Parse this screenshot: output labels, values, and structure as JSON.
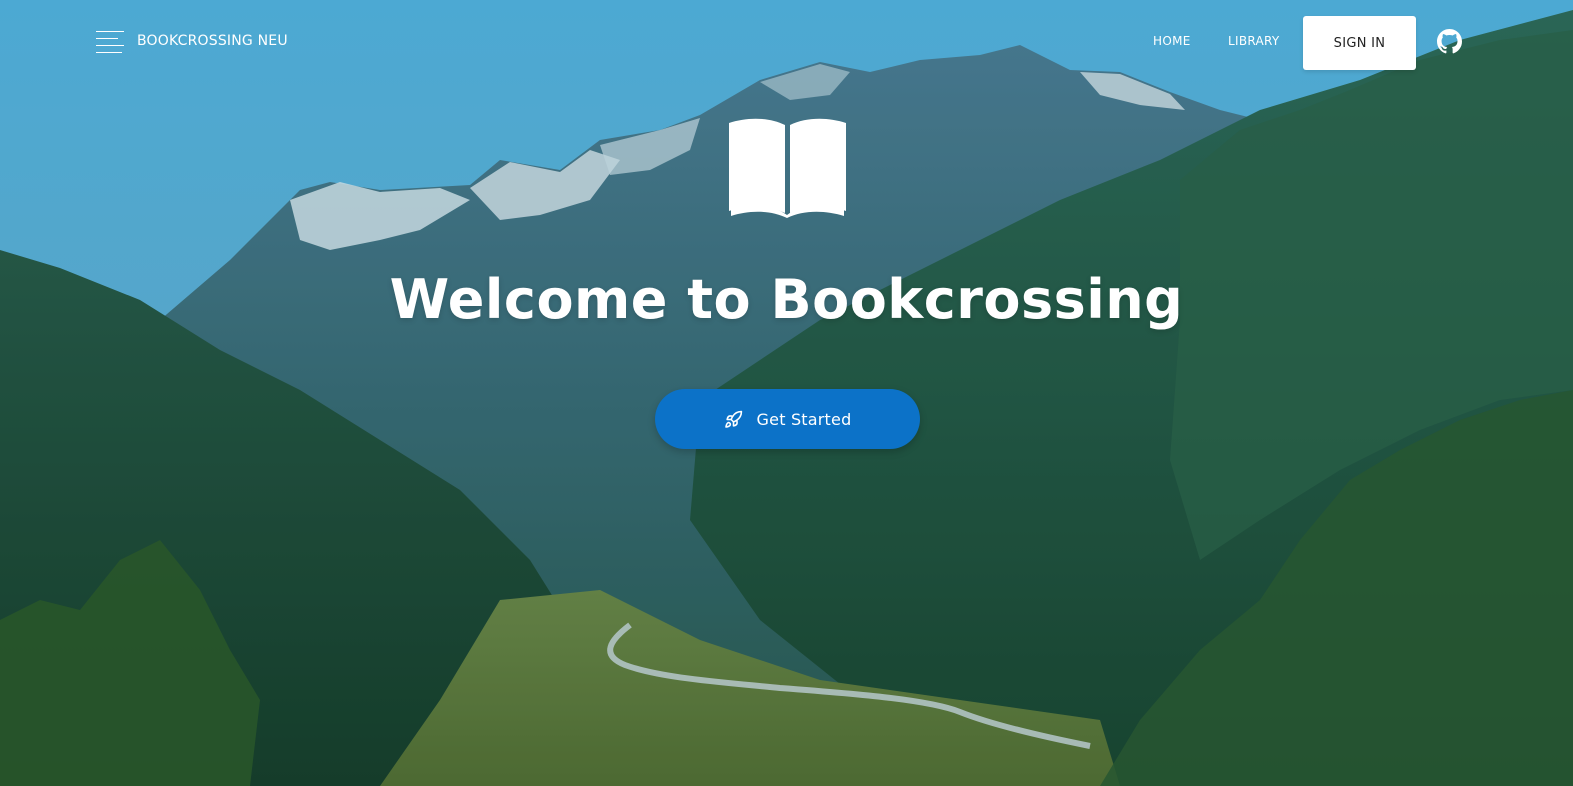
{
  "navbar": {
    "brand": "BOOKCROSSING NEU",
    "links": [
      {
        "label": "HOME"
      },
      {
        "label": "LIBRARY"
      }
    ],
    "sign_in_label": "SIGN IN",
    "github_icon": "github-icon",
    "menu_icon": "hamburger-menu-icon"
  },
  "hero": {
    "icon": "open-book-icon",
    "title": "Welcome to Bookcrossing",
    "cta_label": "Get Started",
    "cta_icon": "rocket-icon"
  },
  "colors": {
    "accent": "#0c72c8",
    "text": "#ffffff",
    "sign_in_bg": "#ffffff"
  }
}
